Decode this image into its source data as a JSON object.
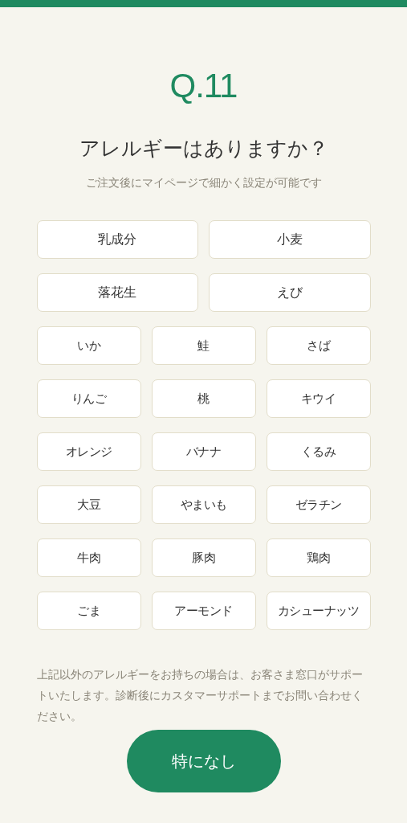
{
  "question_number": "Q.11",
  "title": "アレルギーはありますか？",
  "subtitle": "ご注文後にマイページで細かく設定が可能です",
  "major_options": [
    {
      "label": "乳成分",
      "selected": false
    },
    {
      "label": "小麦",
      "selected": false
    },
    {
      "label": "落花生",
      "selected": false
    },
    {
      "label": "えび",
      "selected": false
    }
  ],
  "other_options": [
    {
      "label": "いか",
      "selected": false
    },
    {
      "label": "鮭",
      "selected": false
    },
    {
      "label": "さば",
      "selected": false
    },
    {
      "label": "りんご",
      "selected": false
    },
    {
      "label": "桃",
      "selected": false
    },
    {
      "label": "キウイ",
      "selected": false
    },
    {
      "label": "オレンジ",
      "selected": false
    },
    {
      "label": "バナナ",
      "selected": false
    },
    {
      "label": "くるみ",
      "selected": false
    },
    {
      "label": "大豆",
      "selected": false
    },
    {
      "label": "やまいも",
      "selected": false
    },
    {
      "label": "ゼラチン",
      "selected": false
    },
    {
      "label": "牛肉",
      "selected": false
    },
    {
      "label": "豚肉",
      "selected": false
    },
    {
      "label": "鶏肉",
      "selected": false
    },
    {
      "label": "ごま",
      "selected": false
    },
    {
      "label": "アーモンド",
      "selected": false
    },
    {
      "label": "カシューナッツ",
      "selected": false
    }
  ],
  "note": "上記以外のアレルギーをお持ちの場合は、お客さま窓口がサポートいたします。診断後にカスタマーサポートまでお問い合わせください。",
  "none_button": "特になし"
}
